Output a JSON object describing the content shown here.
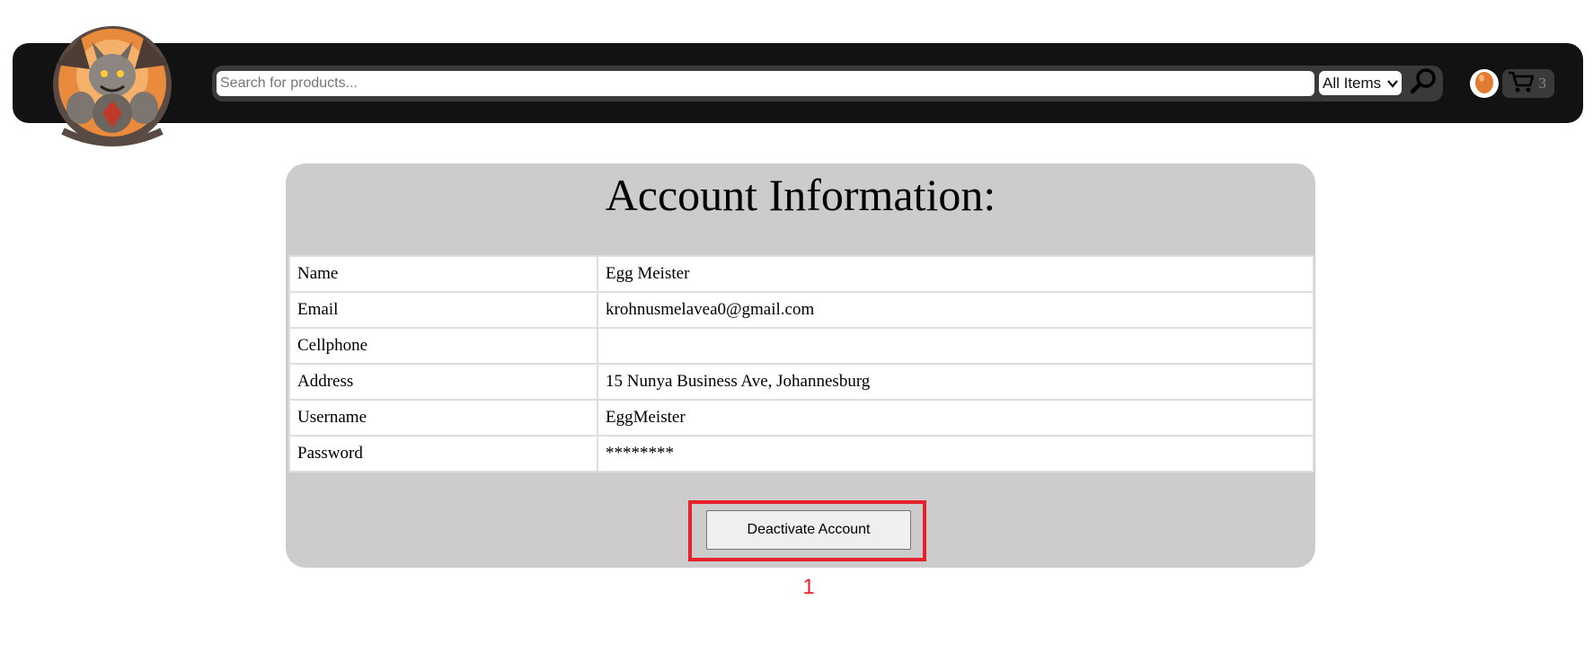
{
  "header": {
    "search": {
      "placeholder": "Search for products...",
      "value": ""
    },
    "category_select": {
      "selected": "All Items"
    },
    "cart": {
      "count": "3"
    },
    "icons": {
      "logo": "dragon-crest-logo",
      "search": "magnifier-icon",
      "profile": "egg-avatar-icon",
      "cart": "shopping-cart-icon"
    }
  },
  "account": {
    "title": "Account Information:",
    "rows": [
      {
        "label": "Name",
        "value": "Egg Meister"
      },
      {
        "label": "Email",
        "value": "krohnusmelavea0@gmail.com"
      },
      {
        "label": "Cellphone",
        "value": ""
      },
      {
        "label": "Address",
        "value": "15 Nunya Business Ave, Johannesburg"
      },
      {
        "label": "Username",
        "value": "EggMeister"
      },
      {
        "label": "Password",
        "value": "********"
      }
    ],
    "deactivate_label": "Deactivate Account"
  },
  "annotation": {
    "label": "1"
  },
  "colors": {
    "header_bg": "#121212",
    "card_bg": "#cccccc",
    "highlight": "#e8202a"
  }
}
